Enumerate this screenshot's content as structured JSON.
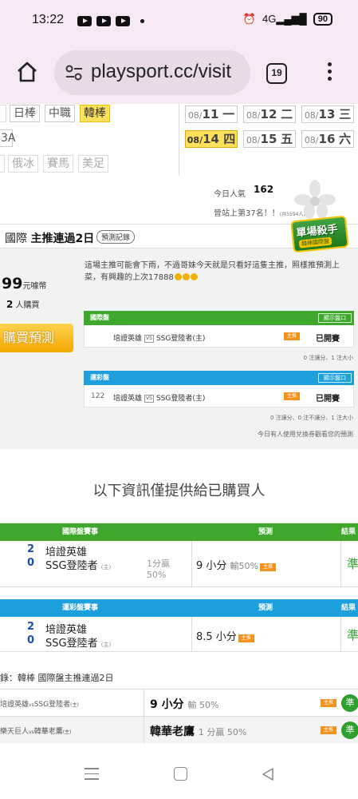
{
  "status_bar": {
    "time": "13:22",
    "network": "4G",
    "battery": "90",
    "notification_icons": [
      "youtube-icon",
      "youtube-icon",
      "youtube-icon"
    ],
    "system_icons": [
      "alarm-icon",
      "volte-icon",
      "signal-icon",
      "battery-icon"
    ]
  },
  "browser": {
    "url": "playsport.cc/visit",
    "tab_count": "19"
  },
  "sport_tabs": {
    "row1": [
      "日棒",
      "中職",
      "韓棒"
    ],
    "active": "韓棒",
    "row2_partial": "3A",
    "row3": [
      "俄冰",
      "賽馬",
      "美足"
    ]
  },
  "dates": [
    {
      "md": "08/",
      "day": "11",
      "wd": "一",
      "active": false
    },
    {
      "md": "08/",
      "day": "12",
      "wd": "二",
      "active": false
    },
    {
      "md": "08/",
      "day": "13",
      "wd": "三",
      "active": false
    },
    {
      "md": "08/",
      "day": "14",
      "wd": "四",
      "active": true
    },
    {
      "md": "08/",
      "day": "15",
      "wd": "五",
      "active": false
    },
    {
      "md": "08/",
      "day": "16",
      "wd": "六",
      "active": false
    }
  ],
  "popularity": {
    "label": "今日人氣",
    "value": "162",
    "rank_text": "晉站上第37名！！",
    "rank_note": "(共5594人)"
  },
  "prediction_panel": {
    "title_prefix": "國際",
    "title_main": "主推連過2日",
    "record_button": "預測記錄",
    "badge_line1": "單場殺手",
    "badge_line2": "韓棒國際盤",
    "price": "99",
    "price_unit": "元噱幣",
    "buyers_count": "2",
    "buyers_suffix": "人購買",
    "buy_button": "購買預測",
    "note": "這場主推可能會下雨，不過哥妹今天就是只看好這隻主推，照樣推預測上菜，有興趣的上次17888"
  },
  "market_international": {
    "title": "國際盤",
    "show_button": "顯示盤口",
    "teams": "培證英雄",
    "vs": "VS",
    "opponent": "SSG登陸者(主)",
    "pick_badge": "主推",
    "status": "已開賽",
    "note": "0 注讓分、1 注大小"
  },
  "market_lottery": {
    "title": "運彩盤",
    "show_button": "顯示盤口",
    "game_no": "122",
    "teams": "培證英雄",
    "vs": "VS",
    "opponent": "SSG登陸者(主)",
    "pick_badge": "主推",
    "status": "已開賽",
    "note": "0 注讓分、0 注不讓分、1 注大小",
    "footer": "今日有人使用兌換券觀看您的預測"
  },
  "info_title": "以下資訊僅提供給已購買人",
  "table_international": {
    "header_game": "國際盤賽事",
    "header_pred": "預測",
    "header_result": "結果",
    "away_score": "2",
    "away_team": "培證英雄",
    "home_score": "0",
    "home_team": "SSG登陸者",
    "home_tag": "(主)",
    "result_line1": "1分贏",
    "result_line2": "50%",
    "prediction": "9 小分",
    "prediction_sub": "輸50%",
    "pick_badge": "主推",
    "result": "準"
  },
  "table_lottery": {
    "header_game": "運彩盤賽事",
    "header_pred": "預測",
    "header_result": "結果",
    "away_score": "2",
    "away_team": "培證英雄",
    "home_score": "0",
    "home_team": "SSG登陸者",
    "home_tag": "(主)",
    "prediction": "8.5 小分",
    "pick_badge": "主推",
    "result": "準"
  },
  "record": {
    "title": "錄：韓棒 國際盤主推連過2日",
    "rows": [
      {
        "match": "培證英雄",
        "vs": "vs",
        "opp": "SSG登陸者",
        "tag": "(主)",
        "pred": "9 小分",
        "sub": "輸 50%",
        "badge": "主推",
        "result": "準"
      },
      {
        "match": "樂天巨人",
        "vs": "vs",
        "opp": "韓華老鷹",
        "tag": "(主)",
        "pred": "韓華老鷹",
        "sub": "1 分贏 50%",
        "badge": "主推",
        "result": "準"
      }
    ]
  },
  "colors": {
    "green": "#3ea82c",
    "blue": "#1ea0dc",
    "yellow": "#ffe05c",
    "orange": "#f4921f",
    "status_bar_bg": "#f6e9f3"
  }
}
